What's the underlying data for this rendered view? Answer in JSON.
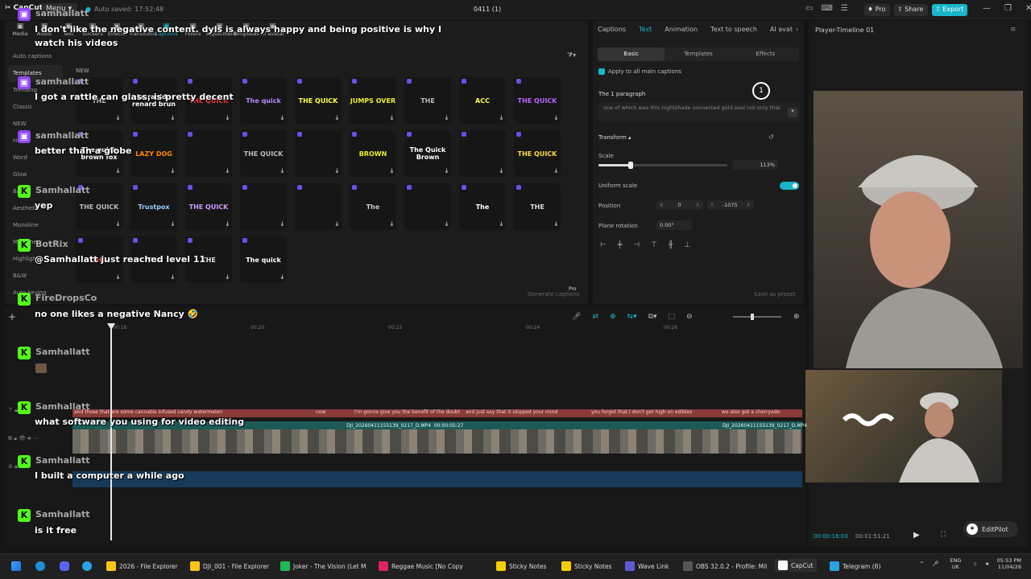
{
  "app": {
    "name": "CapCut",
    "menu_label": "Menu",
    "autosave": "Auto saved: 17:52:48",
    "project_title": "0411 (1)",
    "pro_label": "Pro",
    "share_label": "Share",
    "export_label": "Export"
  },
  "toolbar": {
    "items": [
      "Media",
      "Audio",
      "Text",
      "Stickers",
      "Effects",
      "Transitions",
      "Captions",
      "Filters",
      "Adjustment",
      "Templates",
      "AI avatar"
    ],
    "active": "Captions"
  },
  "sidebar": {
    "items": [
      "Auto captions",
      "Templates",
      "Trending",
      "Classic",
      "NEW",
      "Hits",
      "Word",
      "Glow",
      "Basic",
      "Aesthetic",
      "Monoline",
      "Multiline",
      "Highlight",
      "B&W",
      "Auto keying"
    ],
    "selected": "Templates"
  },
  "grid": {
    "new_label": "NEW",
    "tiles": [
      "THE",
      "Le rapide renard brun",
      "THE QUICK",
      "The quick",
      "THE QUICK",
      "JUMPS OVER",
      "THE",
      "ACC",
      "THE QUICK",
      "The quick brown fox",
      "LAZY DOG",
      "",
      "THE QUICK",
      "",
      "BROWN",
      "The Quick Brown",
      "",
      "THE QUICK",
      "THE QUICK",
      "Trustpox",
      "THE QUICK",
      "",
      "",
      "The",
      "",
      "The",
      "THE",
      "THE",
      "The",
      "THE",
      "The quick"
    ],
    "generate_label": "Generate captions",
    "pro_tag": "Pro"
  },
  "right_panel": {
    "tabs": [
      "Captions",
      "Text",
      "Animation",
      "Text to speech",
      "AI avat"
    ],
    "active_tab": "Text",
    "subtabs": [
      "Basic",
      "Templates",
      "Effects"
    ],
    "active_subtab": "Basic",
    "apply_label": "Apply to all main captions",
    "paragraph_label": "The 1 paragraph",
    "paragraph_text": "one of which was this nightshade connected gold seal not only that",
    "paragraph_badge": "1",
    "transform_label": "Transform",
    "scale_label": "Scale",
    "scale_value": "113%",
    "scale_fraction": 0.25,
    "uniform_scale_label": "Uniform scale",
    "position_label": "Position",
    "pos_x_label": "X",
    "pos_x": "0",
    "pos_y_label": "Y",
    "pos_y": "-1075",
    "rotation_label": "Plane rotation",
    "rotation_value": "0.00°",
    "save_preset": "Save as preset"
  },
  "player": {
    "title": "Player-Timeline 01",
    "current_time": "00:00:18:03",
    "duration": "00:01:51:21",
    "editpilot": "EditPilot"
  },
  "timeline": {
    "ruler": [
      "00:18",
      "00:20",
      "00:22",
      "00:24",
      "00:26"
    ],
    "captions": [
      "and those that are some cannabis infused candy watermelon",
      "now",
      "I'm gonna give you the benefit of the doubt",
      "and just say that it skipped your mind",
      "you forgot that I don't get high on edibles",
      "we also got a cherryade"
    ],
    "clip_name": "DJI_20260411155139_0217_D.MP4",
    "clip_time": "00:00:05:27"
  },
  "chat": [
    {
      "name": "samhallatt",
      "badge": "twitch",
      "msg": "I don't like the negative content. dyls is always happy and being positive is why I"
    },
    {
      "name": "",
      "badge": "",
      "msg": "watch his videos"
    },
    {
      "name": "samhallatt",
      "badge": "twitch",
      "msg": "I got a rattle can glass, is pretty decent"
    },
    {
      "name": "samhallatt",
      "badge": "twitch",
      "msg": "better than a globe"
    },
    {
      "name": "Samhallatt",
      "badge": "kick",
      "msg": "yep"
    },
    {
      "name": "BotRix",
      "badge": "kick",
      "msg": "@Samhallatt just reached level 11"
    },
    {
      "name": "FireDropsCo",
      "badge": "kick",
      "msg": "no one likes a negative Nancy 🤣"
    },
    {
      "name": "Samhallatt",
      "badge": "kick",
      "msg": ""
    },
    {
      "name": "Samhallatt",
      "badge": "kick",
      "msg": "what software you using for video editing"
    },
    {
      "name": "Samhallatt",
      "badge": "kick",
      "msg": "I built a computer a while ago"
    },
    {
      "name": "Samhallatt",
      "badge": "kick",
      "msg": "is it free"
    }
  ],
  "taskbar": {
    "items": [
      "2026 - File Explorer",
      "DJI_001 - File Explorer",
      "Joker - The Vision (Let M",
      "Reggae Music [No Copy",
      "Sticky Notes",
      "Sticky Notes",
      "Wave Link",
      "OBS 32.0.2 - Profile: Mil",
      "CapCut",
      "Telegram (8)"
    ],
    "lang": "ENG UK",
    "time": "05:53 PM",
    "date": "11/04/26"
  },
  "colors": {
    "accent": "#1ab5c9",
    "kick": "#53fc18",
    "twitch": "#9146ff",
    "caption_track": "#8a3a37",
    "video_track": "#1d5a57"
  }
}
